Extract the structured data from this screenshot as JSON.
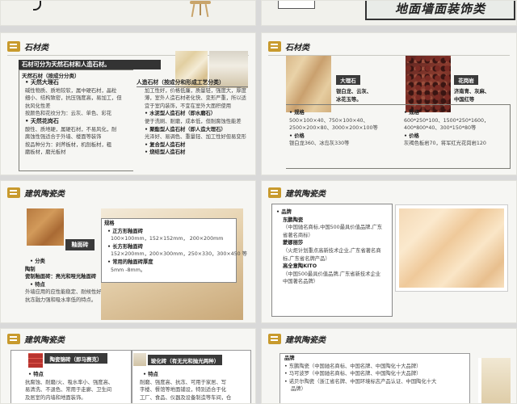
{
  "top_left": {
    "visible": true
  },
  "top_right": {
    "banner": "地面墙面装饰类"
  },
  "s1": {
    "title": "石材类",
    "heading": "石材可分为天然石材和人造石材。",
    "subheading": "天然石材（按成分分类）",
    "marble_title": "天然大理石",
    "marble_lines": [
      "碱性物质、质地较软，属中硬石材，晶粒",
      "细小、结构致密，抗压强度高，易加工，但",
      "抗风化性差",
      "按颜色和花纹分为：云灰、单色、彩花"
    ],
    "granite_title": "天然花岗石",
    "granite_lines": [
      "酸性、质地硬，属硬石材，不易风化，耐",
      "腐蚀性强适合于外墙、楼面等装饰",
      "按品种分为：剁斧板材，机刨板材，粗",
      "磨板材，磨光板材"
    ],
    "artificial_title": "人造石材（按成分和形成工艺分类）",
    "artificial_lines": [
      "加工性好，价格低廉，质量轻，强度大，厚度",
      "薄，室外人造石材老化快、变形严重，所以适",
      "宜于室内装饰，不宜在室外大面积使用"
    ],
    "t1": "水泥型人造石材（即水磨石）",
    "t1_line": "便于洗刷、耐磨，成本低，但耐腐蚀性能差",
    "t2": "聚酯型人造石材（即人造大理石）",
    "t2_lines": [
      "光泽好、易调色、重量轻、加工性好但易变形"
    ],
    "t3": "复合型人造石材",
    "t4": "烧结型人造石材"
  },
  "s2": {
    "title": "石材类",
    "label_marble": "大理石",
    "label_granite": "花岗岩",
    "marble_colors": [
      "银白龙、云灰、",
      "冰花玉等。"
    ],
    "granite_colors": [
      "济南青、灰麻、",
      "中国红等"
    ],
    "spec": "规格",
    "spec_m": "500×100×40、750×100×40、",
    "spec_m2": "2500×200×80、3000×200×100等",
    "spec_g": "600*250*100、1500*250*1600，",
    "spec_g2": "400*800*40、300*150*80等",
    "price": "价格",
    "price_m": "银白龙360、冰岛灰330等",
    "price_g": "灰褐色板岩70，将军红光花岗岩120"
  },
  "s3": {
    "title": "建筑陶瓷类",
    "tile_label": "釉面砖",
    "cls": "分类",
    "c1": "陶制",
    "c2": "瓷制釉面砖：亮光和哑光釉面砖",
    "feat": "特点",
    "feat_lines": [
      "外墙应用的应性能稳定、耐候性好，",
      "抗冻融力强和吸水率低的特点。"
    ],
    "spec": "规格",
    "s1": "正方形釉面砖",
    "s1_v": "100×100mm，152×152mm， 200×200mm",
    "s2": "长方形釉面砖",
    "s2_v": "152×200mm，200×300mm，250×330，300×450 等",
    "s3": "常用的釉面砖厚度",
    "s3_v": "5mm -8mm。"
  },
  "s4": {
    "title": "建筑陶瓷类",
    "brand": "品牌",
    "b1": "东鹏陶瓷",
    "b1_d": [
      "（中国驰名商标,中国500最具价值品牌,广东",
      "省著名商标）"
    ],
    "b2": "蒙娜丽莎",
    "b2_d": [
      "（火炬计划重点高新技术企业,广东省著名商",
      "标,广东省名牌产品）"
    ],
    "b3": "高全意陶KITO",
    "b3_d": [
      "（中国500最具价值品牌,广东省新技术企业",
      "中国著名品牌）"
    ]
  },
  "s5": {
    "title": "建筑陶瓷类",
    "red_label": "陶瓷锦砖（即马赛克）",
    "glazed_label": "玻化砖（有无光和抛光两种）",
    "feat_l": "特点",
    "feat_l_lines": [
      "抗腐蚀、耐磨/火、吸水率小、强度高、",
      "易清洗、不退色、常用于走廊、卫生间",
      "及居室的内墙和地面装饰。"
    ],
    "feat_r": "特点",
    "feat_r_lines": [
      "耐磨、强度高、抗冻、可用于家居、写",
      "字楼、餐馆等地面铺设，特别适合于化",
      "工厂、食品、仪器及设备制造等车间，仓"
    ]
  },
  "s6": {
    "title": "建筑陶瓷类",
    "brand": "品牌",
    "lines": [
      "东鹏陶瓷（中国驰名商标、中国名牌、中国陶化十大品牌）",
      "马可波罗（中国驰名商标、中国名牌、中国陶化十大品牌）",
      "诺贝尔陶瓷（浙江省名牌、中国环境标志产品认证、中国陶化十大",
      "品牌）"
    ]
  }
}
